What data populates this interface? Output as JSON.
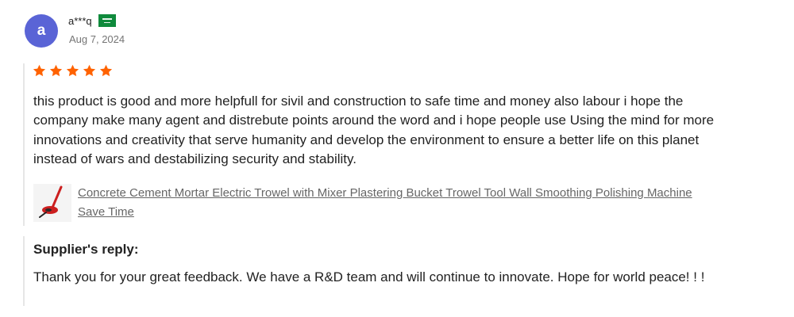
{
  "reviewer": {
    "avatar_letter": "a",
    "name": "a***q",
    "country_flag": "saudi-arabia-flag-icon",
    "date": "Aug 7, 2024"
  },
  "rating": {
    "stars": 5,
    "max_stars": 5,
    "color": "#ff6200"
  },
  "review": {
    "text": "this product is good and more helpfull for sivil and construction to safe time and money also labour i hope the company make many agent and distrebute points around the word and i hope people use Using the mind for more innovations and creativity that serve humanity and develop the environment to ensure a better life on this planet instead of wars and destabilizing security and stability."
  },
  "product": {
    "image_icon": "trowel-machine-icon",
    "title": "Concrete Cement Mortar Electric Trowel with Mixer Plastering Bucket Trowel Tool Wall Smoothing Polishing Machine Save Time"
  },
  "supplier_reply": {
    "title": "Supplier's reply:",
    "text": "Thank you for your great feedback. We have a R&D team and will continue to innovate. Hope for world peace! ! !"
  },
  "colors": {
    "avatar": "#5a64d6",
    "star": "#ff6200",
    "link": "#666666",
    "border": "#e6e6e6"
  }
}
